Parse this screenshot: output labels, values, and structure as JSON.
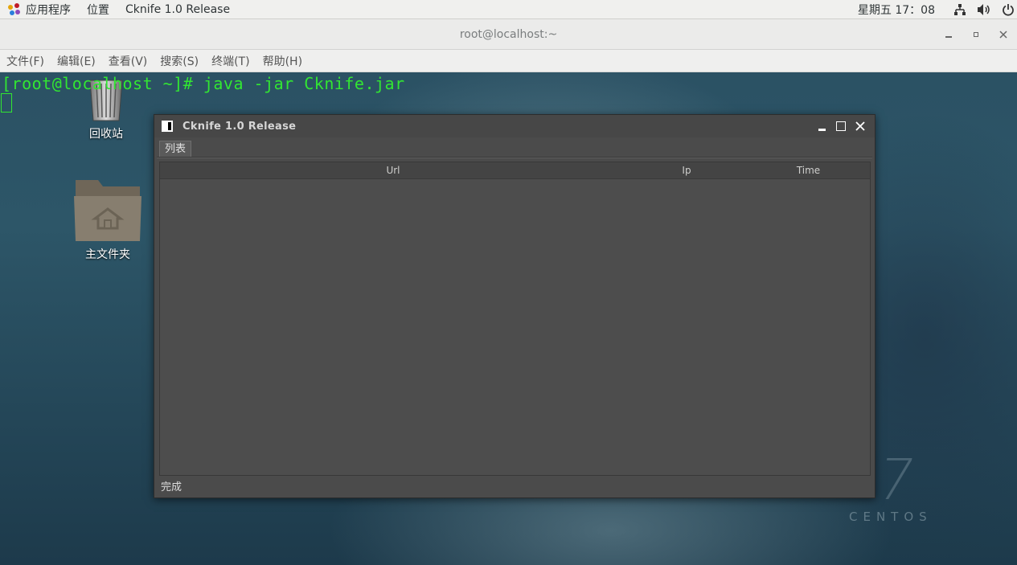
{
  "top_panel": {
    "applications": "应用程序",
    "places": "位置",
    "active_app": "Cknife 1.0 Release",
    "clock": "星期五 17：08"
  },
  "terminal": {
    "title": "root@localhost:~",
    "menu": [
      "文件(F)",
      "编辑(E)",
      "查看(V)",
      "搜索(S)",
      "终端(T)",
      "帮助(H)"
    ],
    "command_line": "[root@localhost ~]# java -jar Cknife.jar"
  },
  "desktop": {
    "trash_label": "回收站",
    "home_label": "主文件夹",
    "watermark_number": "7",
    "watermark_text": "CENTOS"
  },
  "cknife": {
    "title": "Cknife 1.0 Release",
    "tab_label": "列表",
    "columns": [
      "Url",
      "Ip",
      "Time"
    ],
    "status": "完成"
  },
  "colors": {
    "terminal_text": "#32e632",
    "window_bg": "#4b4b4b",
    "panel_bg": "#f0f0ee"
  }
}
